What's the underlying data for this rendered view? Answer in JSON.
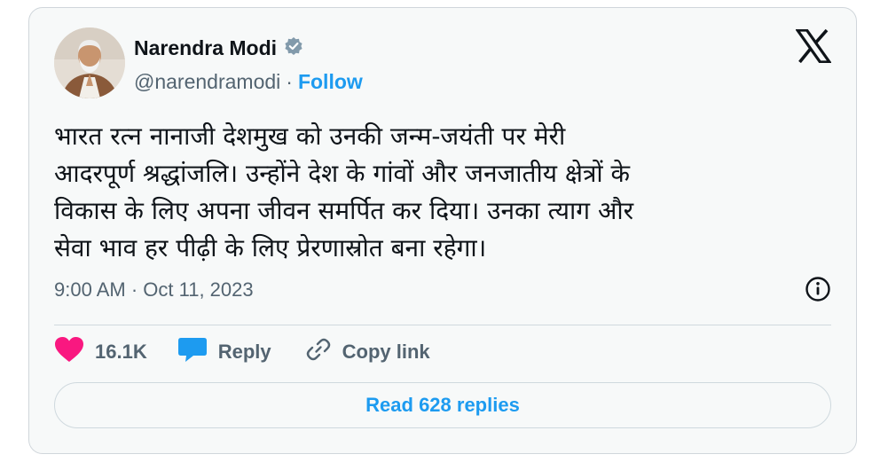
{
  "author": {
    "name": "Narendra Modi",
    "handle": "@narendramodi",
    "separator": "·",
    "follow_label": "Follow",
    "verified_icon": "verified-badge-icon",
    "avatar_icon": "profile-photo"
  },
  "tweet": {
    "lines": [
      "भारत रत्न नानाजी देशमुख को उनकी जन्म-जयंती पर मेरी",
      "आदरपूर्ण श्रद्धांजलि। उन्होंने देश के गांवों और जनजातीय क्षेत्रों के",
      "विकास के लिए अपना जीवन समर्पित कर दिया। उनका त्याग और",
      "सेवा भाव हर पीढ़ी के लिए प्रेरणास्रोत बना रहेगा।"
    ],
    "timestamp": "9:00 AM · Oct 11, 2023"
  },
  "actions": {
    "like_count": "16.1K",
    "reply_label": "Reply",
    "copy_link_label": "Copy link",
    "read_replies_label": "Read 628 replies"
  },
  "icons": {
    "brand": "x-logo-icon",
    "info": "info-icon",
    "like": "heart-icon",
    "reply": "speech-bubble-icon",
    "copy": "link-icon"
  },
  "colors": {
    "accent": "#1d9bf0",
    "like": "#f91880",
    "muted": "#536471",
    "card_bg": "#f7f9f9",
    "verified": "#829aab"
  }
}
